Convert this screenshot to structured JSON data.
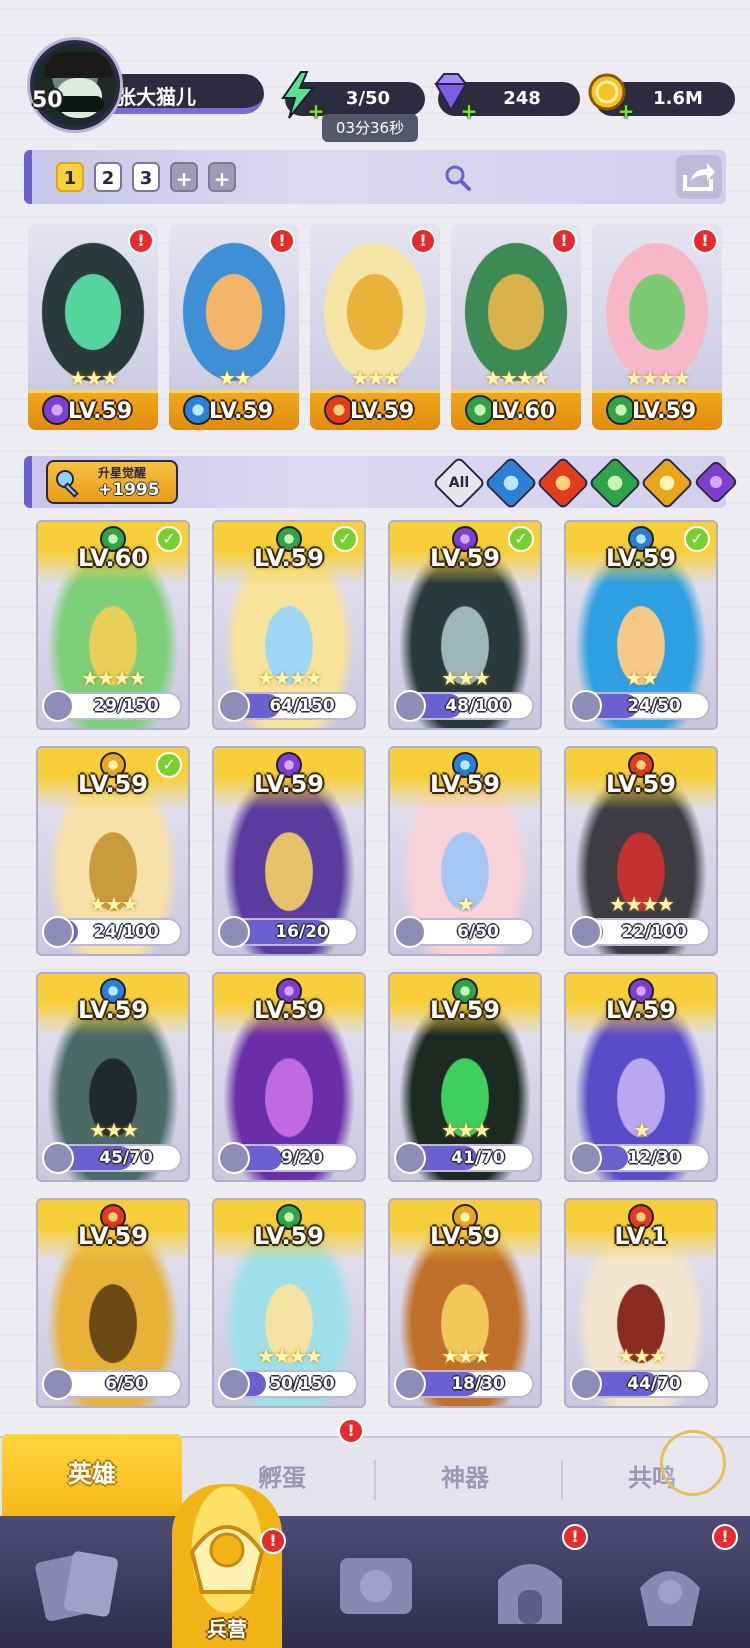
{
  "player": {
    "level": "50",
    "name": "张大猫儿"
  },
  "resources": {
    "energy": "3/50",
    "energy_timer": "03分36秒",
    "gems": "248",
    "coins": "1.6M"
  },
  "team_tabs": [
    "1",
    "2",
    "3",
    "+",
    "+"
  ],
  "team_tabs_active": "1",
  "team": [
    {
      "level": "LV.59",
      "stars": 3,
      "element": "dark",
      "alert": "!",
      "palette": [
        "#2a3a3a",
        "#55d6a0"
      ]
    },
    {
      "level": "LV.59",
      "stars": 2,
      "element": "water",
      "alert": "!",
      "palette": [
        "#3e8fd6",
        "#f3b56a"
      ]
    },
    {
      "level": "LV.59",
      "stars": 3,
      "element": "fire",
      "alert": "!",
      "palette": [
        "#f5e6a8",
        "#e9b23a"
      ]
    },
    {
      "level": "LV.60",
      "stars": 4,
      "element": "wind",
      "alert": "!",
      "palette": [
        "#3c8a54",
        "#d8b24a"
      ]
    },
    {
      "level": "LV.59",
      "stars": 4,
      "element": "wind",
      "alert": "!",
      "palette": [
        "#f6b8c8",
        "#7acb74"
      ]
    }
  ],
  "filter": {
    "star_awaken_label": "升星觉醒",
    "star_awaken_count": "+1995",
    "all_label": "All",
    "elements": [
      "water",
      "fire",
      "wind",
      "light",
      "dark"
    ]
  },
  "heroes": [
    {
      "level": "LV.60",
      "element": "wind",
      "checked": true,
      "stars": 4,
      "frag": "29/150",
      "progress": 0.19,
      "palette": [
        "#7ecf7a",
        "#e8cf5a"
      ]
    },
    {
      "level": "LV.59",
      "element": "wind",
      "checked": true,
      "stars": 4,
      "frag": "64/150",
      "progress": 0.43,
      "palette": [
        "#f7e39a",
        "#9fd7f5"
      ]
    },
    {
      "level": "LV.59",
      "element": "dark",
      "checked": true,
      "stars": 3,
      "frag": "48/100",
      "progress": 0.48,
      "palette": [
        "#2a3a3a",
        "#9fb6b8"
      ]
    },
    {
      "level": "LV.59",
      "element": "water",
      "checked": true,
      "stars": 2,
      "frag": "24/50",
      "progress": 0.48,
      "palette": [
        "#2e9fe0",
        "#f6c98a"
      ]
    },
    {
      "level": "LV.59",
      "element": "light",
      "checked": true,
      "stars": 3,
      "frag": "24/100",
      "progress": 0.24,
      "palette": [
        "#f6e1a8",
        "#c99a3e"
      ]
    },
    {
      "level": "LV.59",
      "element": "dark",
      "checked": false,
      "stars": 0,
      "frag": "16/20",
      "progress": 0.8,
      "palette": [
        "#5a3c9e",
        "#e6c36a"
      ]
    },
    {
      "level": "LV.59",
      "element": "water",
      "checked": false,
      "stars": 1,
      "frag": "6/50",
      "progress": 0.12,
      "palette": [
        "#f6d3d8",
        "#a7c6f2"
      ]
    },
    {
      "level": "LV.59",
      "element": "fire",
      "checked": false,
      "stars": 4,
      "frag": "22/100",
      "progress": 0.22,
      "palette": [
        "#3c3c42",
        "#c23030"
      ]
    },
    {
      "level": "LV.59",
      "element": "water",
      "checked": false,
      "stars": 3,
      "frag": "45/70",
      "progress": 0.64,
      "palette": [
        "#4a6a66",
        "#1f2a2a"
      ]
    },
    {
      "level": "LV.59",
      "element": "dark",
      "checked": false,
      "stars": 0,
      "frag": "9/20",
      "progress": 0.45,
      "palette": [
        "#6a2ea8",
        "#c069e0"
      ]
    },
    {
      "level": "LV.59",
      "element": "wind",
      "checked": false,
      "stars": 3,
      "frag": "41/70",
      "progress": 0.59,
      "palette": [
        "#1c2a22",
        "#3fcf5e"
      ]
    },
    {
      "level": "LV.59",
      "element": "dark",
      "checked": false,
      "stars": 1,
      "frag": "12/30",
      "progress": 0.4,
      "palette": [
        "#5a4cc8",
        "#b8a8f2"
      ]
    },
    {
      "level": "LV.59",
      "element": "fire",
      "checked": false,
      "stars": 0,
      "frag": "6/50",
      "progress": 0.12,
      "palette": [
        "#e8b23a",
        "#6b4a14"
      ]
    },
    {
      "level": "LV.59",
      "element": "wind",
      "checked": false,
      "stars": 4,
      "frag": "50/150",
      "progress": 0.33,
      "palette": [
        "#9fe0e8",
        "#f4e2a2"
      ]
    },
    {
      "level": "LV.59",
      "element": "light",
      "checked": false,
      "stars": 3,
      "frag": "18/30",
      "progress": 0.6,
      "palette": [
        "#c0702a",
        "#f1c85a"
      ]
    },
    {
      "level": "LV.1",
      "element": "fire",
      "checked": false,
      "stars": 3,
      "frag": "44/70",
      "progress": 0.63,
      "palette": [
        "#f2e6d0",
        "#8a2a20"
      ]
    }
  ],
  "subtabs": [
    {
      "label": "英雄",
      "active": true
    },
    {
      "label": "孵蛋",
      "active": false,
      "alert": "!"
    },
    {
      "label": "神器",
      "active": false
    },
    {
      "label": "共鸣",
      "active": false
    }
  ],
  "nav": [
    {
      "label": "",
      "icon": "cards-icon"
    },
    {
      "label": "兵营",
      "icon": "barracks-icon",
      "active": true,
      "alert": "!"
    },
    {
      "label": "",
      "icon": "map-icon"
    },
    {
      "label": "",
      "icon": "temple-icon",
      "alert": "!"
    },
    {
      "label": "",
      "icon": "shop-icon",
      "alert": "!"
    }
  ],
  "colors": {
    "accent": "#6c5fcf",
    "gold": "#f5b917",
    "alert": "#e52b2b",
    "check": "#78cf2e"
  }
}
